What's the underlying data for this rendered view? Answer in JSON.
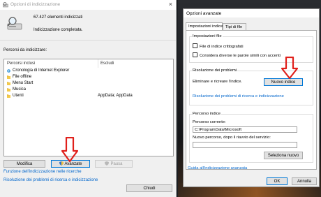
{
  "left_window": {
    "title": "Opzioni di indicizzazione",
    "close_glyph": "×",
    "indexed_count": "67.427 elementi indicizzati",
    "status": "Indicizzazione completata.",
    "locations_label": "Percorsi da indicizzare:",
    "columns": {
      "included": "Percorsi inclusi",
      "excluded": "Escludi"
    },
    "rows": [
      {
        "name": "Cronologia di Internet Explorer",
        "exclude": "",
        "icon": "ie-icon"
      },
      {
        "name": "File offline",
        "exclude": "",
        "icon": "folder-icon"
      },
      {
        "name": "Menu Start",
        "exclude": "",
        "icon": "folder-icon"
      },
      {
        "name": "Musica",
        "exclude": "",
        "icon": "folder-icon"
      },
      {
        "name": "Utenti",
        "exclude": "AppData; AppData",
        "icon": "folder-icon"
      }
    ],
    "buttons": {
      "modify": "Modifica",
      "advanced": "Avanzate",
      "pause": "Pausa",
      "close": "Chiudi"
    },
    "links": {
      "how_works": "Funzione dell'indicizzazione nelle ricerche",
      "troubleshoot": "Risoluzione dei problemi di ricerca e indicizzazione"
    }
  },
  "right_window": {
    "title": "Opzioni avanzate",
    "tabs": [
      "Impostazioni indice",
      "Tipi di file"
    ],
    "file_settings": {
      "label": "Impostazioni file",
      "encrypt": "File di indice crittografati",
      "diacritics": "Considera diverse le parole simili con accenti"
    },
    "troubleshooting": {
      "label": "Risoluzione dei problemi",
      "rebuild_text": "Eliminare e ricreare l'indice.",
      "rebuild_button": "Nuovo indice",
      "link": "Risoluzione dei problemi di ricerca e indicizzazione"
    },
    "index_location": {
      "label": "Percorso indice",
      "current_label": "Percorso corrente:",
      "current_value": "C:\\ProgramData\\Microsoft",
      "new_label": "Nuovo percorso, dopo il riavvio del servizio:",
      "new_value": "",
      "select_button": "Seleziona nuovo"
    },
    "help_link": "Guida all'indicizzazione avanzata",
    "ok": "OK",
    "cancel": "Annulla"
  },
  "colors": {
    "arrow": "#e0201b",
    "link": "#0066cc",
    "default_button_border": "#0078d7"
  }
}
